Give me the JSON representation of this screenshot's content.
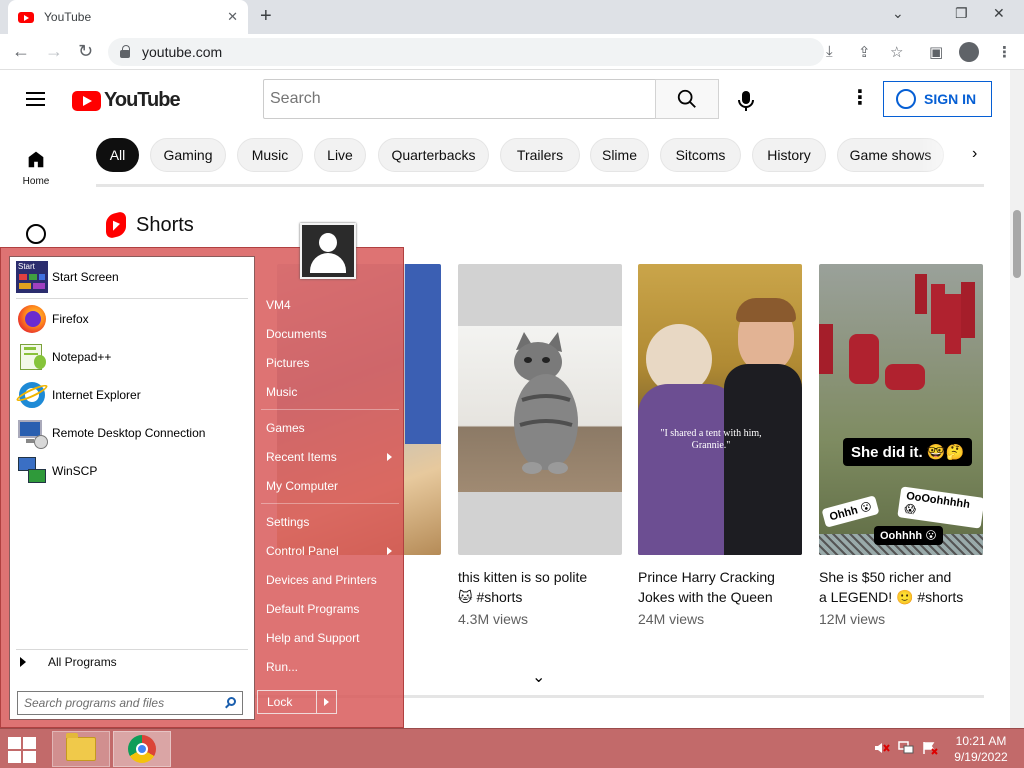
{
  "browser": {
    "tab_title": "YouTube",
    "tab_close": "✕",
    "new_tab": "+",
    "win_minimize": "⌄",
    "win_restore": "❐",
    "win_close": "✕",
    "back": "←",
    "forward": "→",
    "reload": "↻",
    "url": "youtube.com",
    "install_icon": "⤓",
    "share_icon": "⇪",
    "bookmark_icon": "☆",
    "sidepanel_icon": "▣",
    "menu_icon": "⋮"
  },
  "youtube": {
    "logo_text": "YouTube",
    "search_placeholder": "Search",
    "more_icon": "⋮",
    "signin_label": "SIGN IN",
    "chips": [
      "All",
      "Gaming",
      "Music",
      "Live",
      "Quarterbacks",
      "Trailers",
      "Slime",
      "Sitcoms",
      "History",
      "Game shows"
    ],
    "chip_next": "›",
    "guide_home": "Home",
    "shorts_title": "Shorts",
    "more_chevron": "⌄",
    "shorts": [
      {
        "title_line1": "this kitten is so polite",
        "title_line2": "🐱 #shorts",
        "views": "4.3M views"
      },
      {
        "title_line1": "Prince Harry Cracking",
        "title_line2": "Jokes with the Queen",
        "views": "24M views",
        "caption": "\"I shared a tent with him, Grannie.\""
      },
      {
        "title_line1": "She is $50 richer and",
        "title_line2": "a LEGEND! 🙂 #shorts",
        "views": "12M views",
        "caption_main": "She did it. 🤓🤔",
        "caption_a": "Ohhh 😮",
        "caption_b": "OoOohhhhh😱",
        "caption_c": "Oohhhh 😮"
      }
    ]
  },
  "start_menu": {
    "pinned": [
      {
        "label": "Start Screen",
        "icon": "start-screen-icon"
      },
      {
        "label": "Firefox",
        "icon": "firefox-icon"
      },
      {
        "label": "Notepad++",
        "icon": "notepad-plus-plus-icon"
      },
      {
        "label": "Internet Explorer",
        "icon": "internet-explorer-icon"
      },
      {
        "label": "Remote Desktop Connection",
        "icon": "remote-desktop-icon"
      },
      {
        "label": "WinSCP",
        "icon": "winscp-icon"
      }
    ],
    "start_icon_text": "Start",
    "all_programs": "All Programs",
    "search_placeholder": "Search programs and files",
    "right_items": [
      "VM4",
      "Documents",
      "Pictures",
      "Music",
      "Games",
      "Recent Items",
      "My Computer",
      "Settings",
      "Control Panel",
      "Devices and Printers",
      "Default Programs",
      "Help and Support",
      "Run..."
    ],
    "lock_label": "Lock"
  },
  "taskbar": {
    "time": "10:21 AM",
    "date": "9/19/2022"
  },
  "colors": {
    "youtube_red": "#ff0000",
    "signin_blue": "#065fd4",
    "start_menu_bg": "#d75454",
    "taskbar_bg": "#c26a6a"
  }
}
